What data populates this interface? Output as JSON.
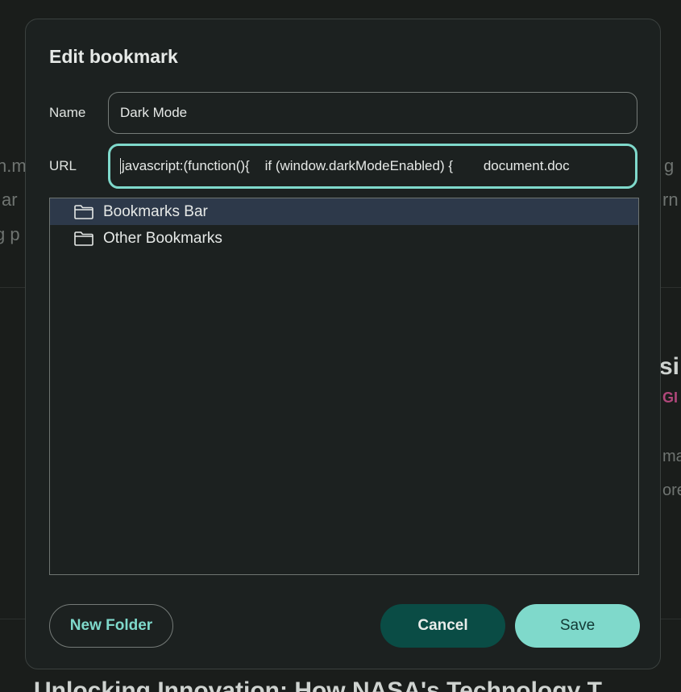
{
  "dialog": {
    "title": "Edit bookmark",
    "name_label": "Name",
    "name_value": "Dark Mode",
    "url_label": "URL",
    "url_value": "javascript:(function(){    if (window.darkModeEnabled) {        document.doc"
  },
  "folders": [
    {
      "label": "Bookmarks Bar",
      "selected": true,
      "icon": "folder-icon"
    },
    {
      "label": "Other Bookmarks",
      "selected": false,
      "icon": "folder-icon"
    }
  ],
  "buttons": {
    "new_folder": "New Folder",
    "cancel": "Cancel",
    "save": "Save"
  },
  "background": {
    "left_fragments": [
      "n.m",
      "ar",
      "g p"
    ],
    "right_fragments": [
      "g",
      "rn"
    ],
    "heading_fragment": "si",
    "tag_fragment": "GI",
    "side_fragments": [
      "ma",
      "ore"
    ],
    "bottom_fragment": "Unlocking Innovation: How NASA's Technology T"
  },
  "colors": {
    "accent": "#7fd9cb",
    "dialog_bg": "#1c2120",
    "selected_row": "#2d394a",
    "cancel_bg": "#0a4c45"
  }
}
